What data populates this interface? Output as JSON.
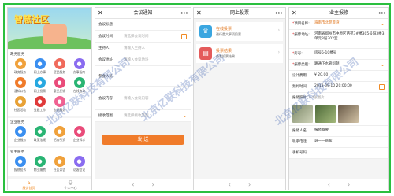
{
  "screen1": {
    "banner_title": "智慧社区",
    "section_gov": "政务服务",
    "gov_items": [
      {
        "label": "政务服务",
        "icon": "document-icon",
        "color": "#f0a13b"
      },
      {
        "label": "网上办事",
        "icon": "handshake-icon",
        "color": "#3b8ff0"
      },
      {
        "label": "便民服务",
        "icon": "service-icon",
        "color": "#f06a5b"
      },
      {
        "label": "办事指南",
        "icon": "guide-icon",
        "color": "#8a6cf0"
      },
      {
        "label": "通知公告",
        "icon": "megaphone-icon",
        "color": "#f07b2a"
      },
      {
        "label": "网上投票",
        "icon": "vote-icon",
        "color": "#27a8e0"
      },
      {
        "label": "意见反馈",
        "icon": "feedback-icon",
        "color": "#e94c7a"
      },
      {
        "label": "在线咨询",
        "icon": "chat-icon",
        "color": "#29b473"
      },
      {
        "label": "社区活动",
        "icon": "activity-icon",
        "color": "#e8a135"
      },
      {
        "label": "党建工作",
        "icon": "flag-icon",
        "color": "#e03a3a"
      },
      {
        "label": "志愿服务",
        "icon": "heart-icon",
        "color": "#f06292"
      }
    ],
    "section_ent": "企业服务",
    "ent_items": [
      {
        "label": "企业服务",
        "icon": "briefcase-icon",
        "color": "#3b8ff0"
      },
      {
        "label": "政策法规",
        "icon": "book-icon",
        "color": "#29b473"
      },
      {
        "label": "招商引资",
        "icon": "building-icon",
        "color": "#f0a13b"
      },
      {
        "label": "企业诉求",
        "icon": "message-icon",
        "color": "#e94c7a"
      }
    ],
    "section_biz": "业主服务",
    "biz_items": [
      {
        "label": "报修投诉",
        "icon": "wrench-icon",
        "color": "#3b8ff0"
      },
      {
        "label": "物业缴费",
        "icon": "wallet-icon",
        "color": "#29b473"
      },
      {
        "label": "社区公告",
        "icon": "bell-icon",
        "color": "#f0a13b"
      },
      {
        "label": "访客登记",
        "icon": "user-icon",
        "color": "#8a6cf0"
      }
    ],
    "tabs": [
      {
        "label": "服务首页",
        "icon": "home-icon"
      },
      {
        "label": "个人中心",
        "icon": "person-icon"
      }
    ]
  },
  "screen2": {
    "title": "会议通知",
    "fields": [
      {
        "key": "会议标题:",
        "value": "",
        "placeholder": ""
      },
      {
        "key": "会议时间:",
        "value": "请选择会议时间",
        "placeholder": ""
      },
      {
        "key": "主持人:",
        "value": "请输入主持人",
        "placeholder": ""
      },
      {
        "key": "会议地址:",
        "value": "请输入会议地址",
        "placeholder": ""
      },
      {
        "key": "参会人员:",
        "value": "",
        "placeholder": ""
      },
      {
        "key": "会议内容:",
        "value": "请输入会议内容",
        "placeholder": ""
      }
    ],
    "recipients_key": "接收范围:",
    "recipients_value": "请选择接收范围",
    "send_label": "发 送"
  },
  "screen3": {
    "title": "网上投票",
    "items": [
      {
        "title": "在线投票",
        "sub": "进行重大事项投票",
        "color": "#3aa6e0",
        "icon": "trophy-icon"
      },
      {
        "title": "投票结果",
        "sub": "查看投票结果",
        "color": "#e45b5b",
        "icon": "chart-icon"
      }
    ]
  },
  "screen4": {
    "title": "业主报修",
    "rows": [
      {
        "key": "项目名称:",
        "value": "海南市北苑景湾"
      },
      {
        "key": "报修地址:",
        "value": "河南省郑州市中原区西苑3#楼305号阳3楼3单元3层302室"
      },
      {
        "key": "房号:",
        "value": "房号5-10楼号"
      },
      {
        "key": "报修类别:",
        "value": "路通下水管问题"
      },
      {
        "key": "设计费用:",
        "value": "¥ 20.00"
      },
      {
        "key": "预约时间:",
        "value": "2018-09-10 20:00:00"
      }
    ],
    "photo_label": "报修照片",
    "photo_hint": "(1-4张图片)",
    "rows2": [
      {
        "key": "报修人名:",
        "value": "报修概要"
      },
      {
        "key": "联系电话:",
        "value": "聂一一商家"
      },
      {
        "key": "手机号码:",
        "value": ""
      }
    ]
  },
  "watermark": "北京亿联科技有限公司"
}
